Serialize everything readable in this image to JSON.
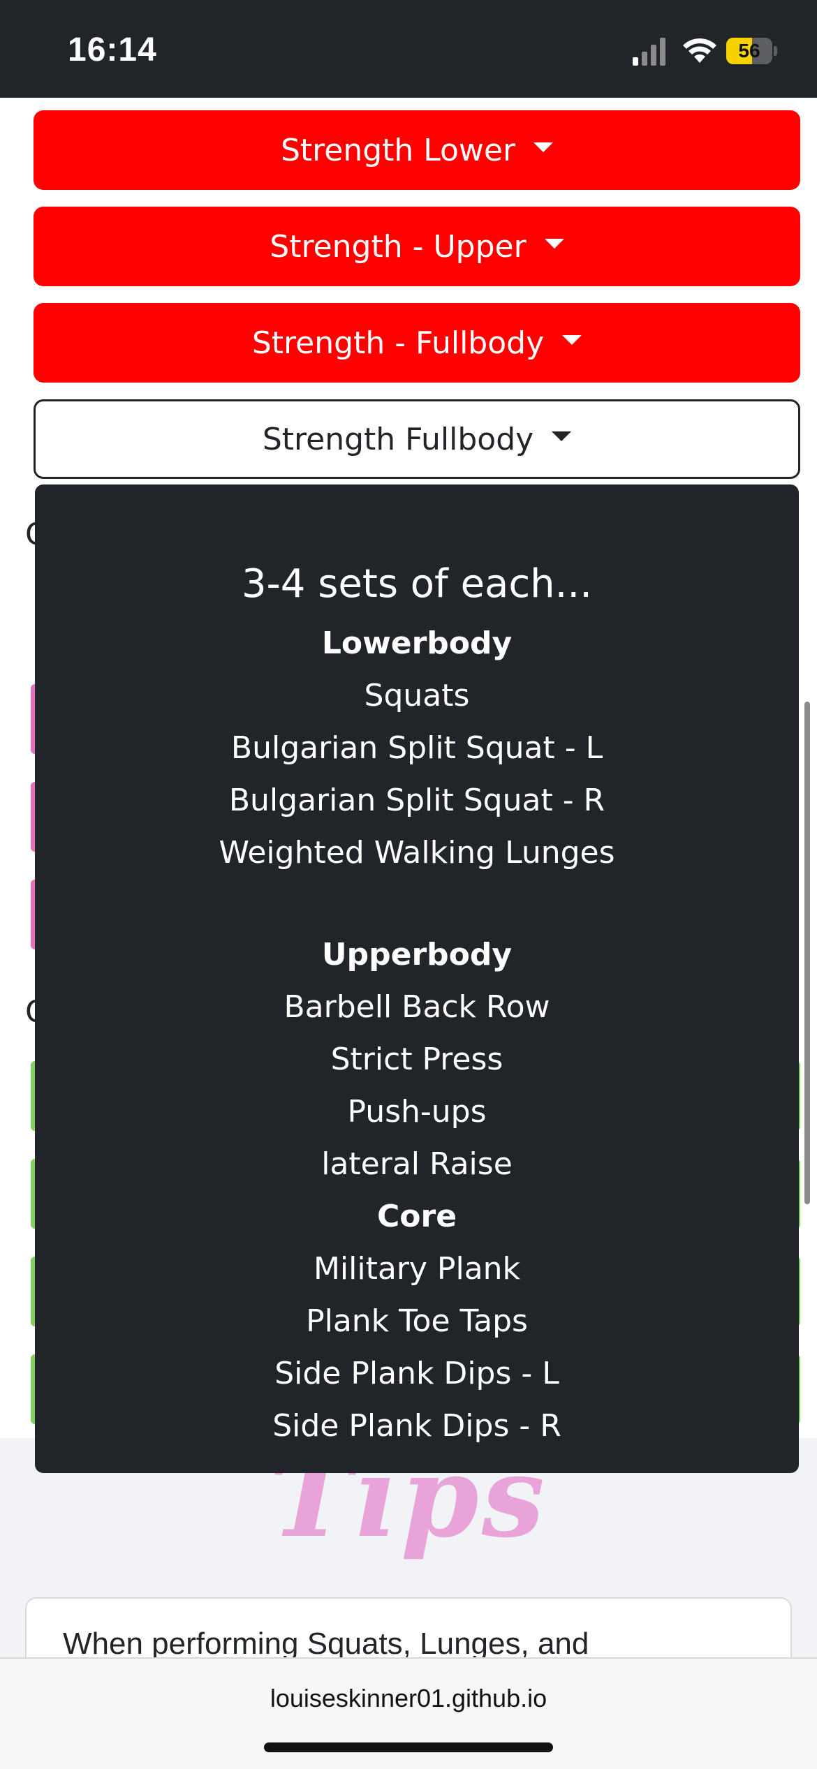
{
  "status_bar": {
    "time": "16:14",
    "battery": "56",
    "icons": [
      "signal-icon",
      "wifi-icon",
      "battery-icon"
    ]
  },
  "dropdowns": [
    {
      "label": "Strength Lower",
      "style": "red"
    },
    {
      "label": "Strength - Upper",
      "style": "red"
    },
    {
      "label": "Strength - Fullbody",
      "style": "red"
    },
    {
      "label": "Strength Fullbody",
      "style": "outline"
    }
  ],
  "menu": {
    "heading": "3-4 sets of each...",
    "lines": [
      {
        "text": "Lowerbody",
        "bold": true
      },
      {
        "text": "Squats",
        "bold": false
      },
      {
        "text": "Bulgarian Split Squat - L",
        "bold": false
      },
      {
        "text": "Bulgarian Split Squat - R",
        "bold": false
      },
      {
        "text": "Weighted Walking Lunges",
        "bold": false
      },
      {
        "text": "Upperbody",
        "bold": true
      },
      {
        "text": "Barbell Back Row",
        "bold": false
      },
      {
        "text": "Strict Press",
        "bold": false
      },
      {
        "text": "Push-ups",
        "bold": false
      },
      {
        "text": "lateral Raise",
        "bold": false
      },
      {
        "text": "Core",
        "bold": true
      },
      {
        "text": "Military Plank",
        "bold": false
      },
      {
        "text": "Plank Toe Taps",
        "bold": false
      },
      {
        "text": "Side Plank Dips - L",
        "bold": false
      },
      {
        "text": "Side Plank Dips - R",
        "bold": false
      }
    ]
  },
  "background_partial": {
    "letter_1": "C",
    "letter_2": "C"
  },
  "tips": {
    "title": "Tips",
    "text": "When performing Squats, Lunges, and"
  },
  "browser": {
    "url": "louiseskinner01.github.io"
  },
  "colors": {
    "red_button": "#ff0000",
    "menu_bg": "#212529",
    "tips_title": "#e8a4d8"
  }
}
